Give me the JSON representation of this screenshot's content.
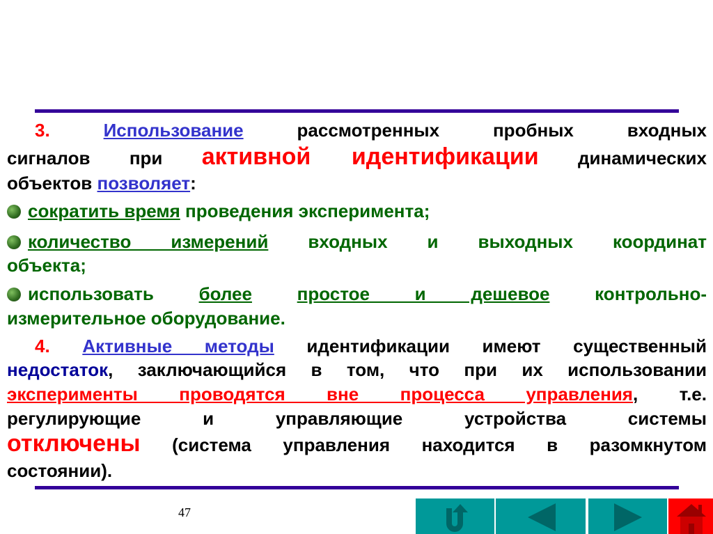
{
  "slide": {
    "p3": {
      "number": "3.",
      "l1_link": "Использование",
      "l1_rest": "рассмотренных пробных входных",
      "l2_a": "сигналов при",
      "l2_red": "активной идентификации",
      "l2_b": "динамических",
      "l3_a": "объектов",
      "l3_link": "позволяет",
      "l3_colon": ":"
    },
    "bullets": [
      {
        "u": "сократить время",
        "rest": "проведения эксперимента;"
      },
      {
        "u": "количество измерений",
        "rest": "входных и выходных координат",
        "cont": "объекта;"
      },
      {
        "a": "использовать",
        "u1": "более",
        "u2": "простое и дешевое",
        "rest": "контрольно-",
        "cont": "измерительное оборудование."
      }
    ],
    "p4": {
      "number": "4.",
      "l1_link": "Активные методы",
      "l1_rest": "идентификации имеют существенный",
      "l2_navy": "недостаток",
      "l2_rest": ", заключающийся в том, что при их использовании",
      "l3_red": "эксперименты проводятся вне процесса управления",
      "l3_rest": ", т.е.",
      "l4": "регулирующие и управляющие устройства системы",
      "l5_red": "отключены",
      "l5_rest": "(система управления находится в разомкнутом",
      "l6": "состоянии)."
    },
    "page_number": "47"
  },
  "nav": {
    "return_icon": "u-turn-arrow-icon",
    "prev_icon": "triangle-left-icon",
    "next_icon": "triangle-right-icon",
    "home_icon": "house-icon",
    "colors": {
      "teal": "#009999",
      "dark_teal": "#006666",
      "home": "#ff0000"
    }
  }
}
